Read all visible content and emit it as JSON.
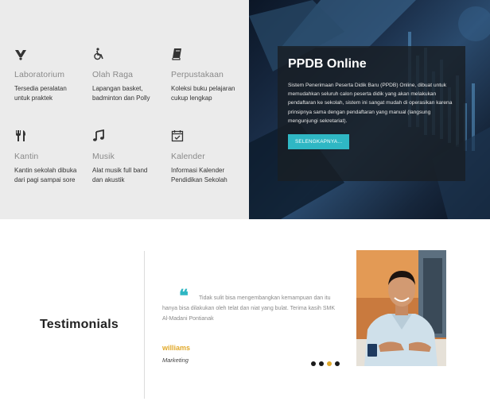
{
  "facilities": [
    {
      "icon": "flask-icon",
      "title": "Laboratorium",
      "desc": [
        "Tersedia peralatan",
        "untuk praktek"
      ]
    },
    {
      "icon": "wheelchair-icon",
      "title": "Olah Raga",
      "desc": [
        "Lapangan basket,",
        "badminton dan Polly"
      ]
    },
    {
      "icon": "book-icon",
      "title": "Perpustakaan",
      "desc": [
        "Koleksi buku pelajaran",
        "cukup lengkap"
      ]
    },
    {
      "icon": "cutlery-icon",
      "title": "Kantin",
      "desc": [
        "Kantin sekolah dibuka",
        "dari pagi sampai sore"
      ]
    },
    {
      "icon": "music-note-icon",
      "title": "Musik",
      "desc": [
        "Alat musik full band",
        "dan akustik"
      ]
    },
    {
      "icon": "calendar-icon",
      "title": "Kalender",
      "desc": [
        "Informasi Kalender",
        "Pendidikan Sekolah"
      ]
    }
  ],
  "hero": {
    "title": "PPDB Online",
    "text": "Sistem Penerimaan Peserta Didik Baru (PPDB) Online, dibuat untuk memudahkan seluruh calon peserta didik yang akan melakukan pendaftaran ke sekolah, sistem ini sangat mudah di operasikan karena prinsipnya sama dengan pendaftaran yang manual (langsung mengunjungi sekretariat).",
    "button_label": "SELENGKAPNYA..."
  },
  "testimonials": {
    "heading": "Testimonials",
    "quote": "Tidak sulit bisa mengembangkan kemampuan dan itu hanya bisa dilakukan oleh telat dan niat yang bulat. Terima kasih SMK Al-Madani Pontianak",
    "name": "williams",
    "role": "Marketing",
    "slides": 4,
    "active_slide": 3
  },
  "colors": {
    "accent": "#2fb7c4",
    "name": "#e1a92a"
  }
}
